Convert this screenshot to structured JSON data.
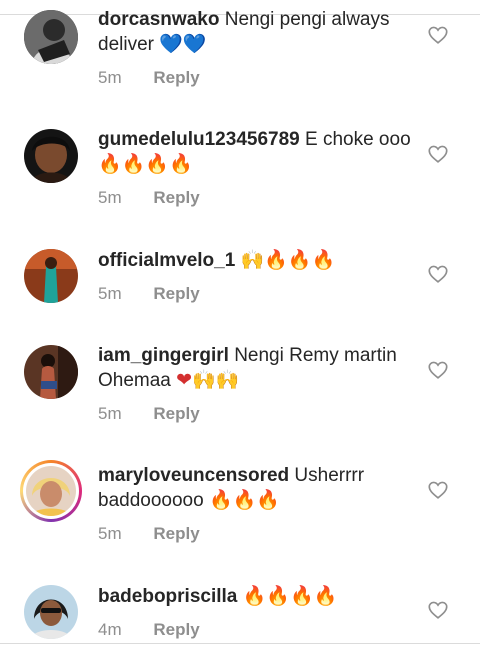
{
  "comments": [
    {
      "username": "dorcasnwako",
      "text": "Nengi pengi always deliver",
      "emoji": "💙💙",
      "time": "5m",
      "reply_label": "Reply"
    },
    {
      "username": "gumedelulu123456789",
      "text": "E choke ooo",
      "emoji": "🔥🔥🔥🔥",
      "time": "5m",
      "reply_label": "Reply"
    },
    {
      "username": "officialmvelo_1",
      "text": "",
      "emoji": "🙌🔥🔥🔥",
      "time": "5m",
      "reply_label": "Reply"
    },
    {
      "username": "iam_gingergirl",
      "text": "Nengi Remy martin Ohemaa",
      "emoji": "❤🙌🙌",
      "time": "5m",
      "reply_label": "Reply"
    },
    {
      "username": "maryloveuncensored",
      "text": "Usherrrr baddoooooo",
      "emoji": "🔥🔥🔥",
      "time": "5m",
      "reply_label": "Reply"
    },
    {
      "username": "badebopriscilla",
      "text": "",
      "emoji": "🔥🔥🔥🔥",
      "time": "4m",
      "reply_label": "Reply"
    }
  ],
  "icons": {
    "like": "heart-outline-icon"
  },
  "colors": {
    "text": "#262626",
    "meta": "#8e8e8e",
    "divider": "#dbdbdb"
  }
}
